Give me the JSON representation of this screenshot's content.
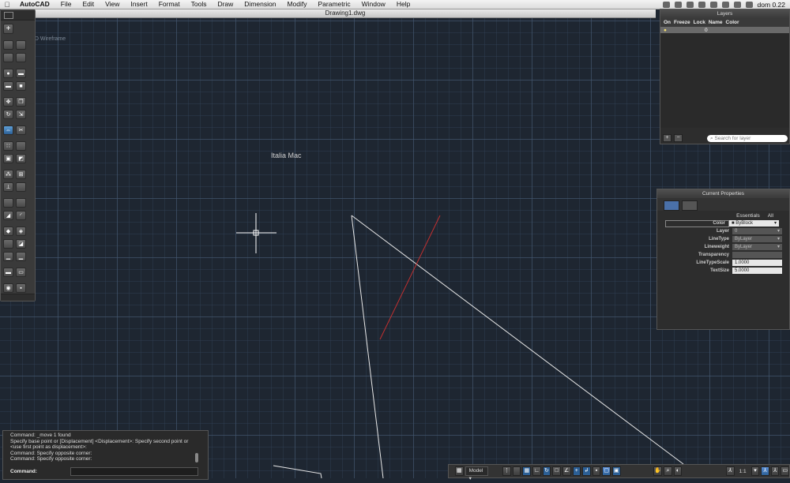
{
  "menubar": {
    "app": "AutoCAD",
    "items": [
      "File",
      "Edit",
      "View",
      "Insert",
      "Format",
      "Tools",
      "Draw",
      "Dimension",
      "Modify",
      "Parametric",
      "Window",
      "Help"
    ],
    "clock": "dom 0.22"
  },
  "window": {
    "title": "Drawing1.dwg"
  },
  "viewport": {
    "label": "2D Wireframe"
  },
  "drawing": {
    "text": "Italia Mac"
  },
  "layers": {
    "title": "Layers",
    "columns": [
      "On",
      "Freeze",
      "Lock",
      "Name",
      "Color"
    ],
    "rows": [
      {
        "name": "0"
      }
    ],
    "search_placeholder": "Search for layer"
  },
  "properties": {
    "title": "Current Properties",
    "filter": [
      "Essentials",
      "All"
    ],
    "rows": [
      {
        "label": "Color",
        "value": "ByBlock"
      },
      {
        "label": "Layer",
        "value": "0"
      },
      {
        "label": "LineType",
        "value": "ByLayer"
      },
      {
        "label": "Lineweight",
        "value": "ByLayer"
      },
      {
        "label": "Transparency",
        "value": ""
      },
      {
        "label": "LineTypeScale",
        "value": "1.0000"
      },
      {
        "label": "TextSize",
        "value": "5.0000"
      }
    ]
  },
  "command": {
    "history": [
      "Command: _move 1 found",
      "Specify base point or [Displacement] <Displacement>: Specify second point or",
      "<use first point as displacement>:",
      "Command: Specify opposite corner:",
      "Command: Specify opposite corner:"
    ],
    "label": "Command:"
  },
  "statusbar": {
    "model": "Model",
    "scale": "1:1"
  },
  "colors": {
    "canvas": "#1e2631",
    "line_white": "#e8e8e8",
    "line_red": "#c03030"
  }
}
